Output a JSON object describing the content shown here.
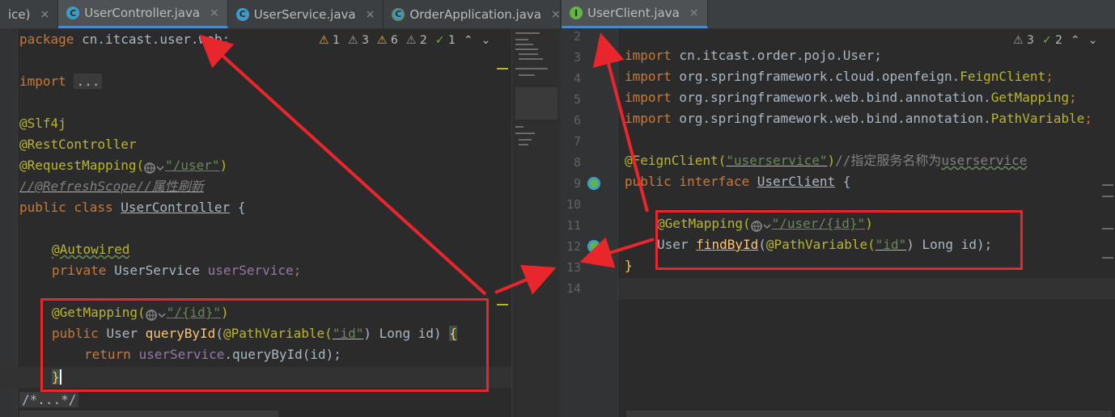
{
  "left_tabs": [
    {
      "label": "ice)",
      "active": false,
      "icon": "none"
    },
    {
      "label": "UserController.java",
      "active": true,
      "icon": "class-icon"
    },
    {
      "label": "UserService.java",
      "active": false,
      "icon": "class-icon"
    },
    {
      "label": "OrderApplication.java",
      "active": false,
      "icon": "spring-boot-class-icon"
    }
  ],
  "right_tabs": [
    {
      "label": "UserClient.java",
      "active": true,
      "icon": "interface-icon"
    }
  ],
  "tab_close_glyph": "×",
  "left_inspections": {
    "warn1": "1",
    "weak3": "3",
    "warn6": "6",
    "weak2": "2",
    "ok1": "1"
  },
  "right_inspections": {
    "weak3": "3",
    "ok2": "2"
  },
  "left_code": {
    "package_kw": "package",
    "package_name": " cn.itcast.user.web;",
    "import_kw": "import",
    "import_fold": "...",
    "slf4j": "@Slf4j",
    "rest": "@RestController",
    "reqmap": "@RequestMapping(",
    "reqmap_path": "\"/user\"",
    "reqmap_close": ")",
    "refresh_comment": "//@RefreshScope//属性刷新",
    "public_kw": "public class ",
    "class_name": "UserController",
    "brace_open": " {",
    "autowired": "@Autowired",
    "private_kw": "private ",
    "svc_type": "UserService ",
    "svc_field": "userService",
    "semi": ";",
    "getmap": "@GetMapping(",
    "getmap_path": "\"/{id}\"",
    "getmap_close": ")",
    "method_public": "public ",
    "method_type": "User ",
    "method_name": "queryById",
    "method_paren": "(",
    "pathvar": "@PathVariable(",
    "pathvar_arg": "\"id\"",
    "pathvar_rest": ") Long id) ",
    "method_brace": "{",
    "return_kw": "return ",
    "return_field": "userService",
    "return_call": ".queryById(id);",
    "close_brace": "}",
    "fold_comment": "/*...*/"
  },
  "right_code": {
    "lines": [
      "2",
      "3",
      "4",
      "5",
      "6",
      "7",
      "8",
      "9",
      "10",
      "11",
      "12",
      "13",
      "14"
    ],
    "import1_kw": "import",
    "import1": " cn.itcast.order.pojo.User;",
    "import2_kw": "import",
    "import2_pkg": " org.springframework.cloud.openfeign.",
    "import2_cls": "FeignClient",
    "import3_kw": "import",
    "import3_pkg": " org.springframework.web.bind.annotation.",
    "import3_cls": "GetMapping",
    "import4_kw": "import",
    "import4_pkg": " org.springframework.web.bind.annotation.",
    "import4_cls": "PathVariable",
    "feign": "@FeignClient(",
    "feign_arg": "\"userservice\"",
    "feign_close": ")",
    "feign_comment_prefix": "//指定服务名称为",
    "feign_comment_word": "userservice",
    "iface_kw": "public interface ",
    "iface_name": "UserClient",
    "iface_brace": " {",
    "getmap": "@GetMapping(",
    "getmap_path": "\"/user/{id}\"",
    "getmap_close": ")",
    "ret_type": "User ",
    "method_name": "findById",
    "paren": "(",
    "pathvar": "@PathVariable(",
    "pathvar_arg": "\"id\"",
    "pathvar_rest": ") Long id);",
    "close_brace": "}"
  },
  "colors": {
    "highlight_box": "#e8262b",
    "keyword": "#cc7832",
    "annotation": "#bbb529",
    "string": "#6a8759"
  }
}
